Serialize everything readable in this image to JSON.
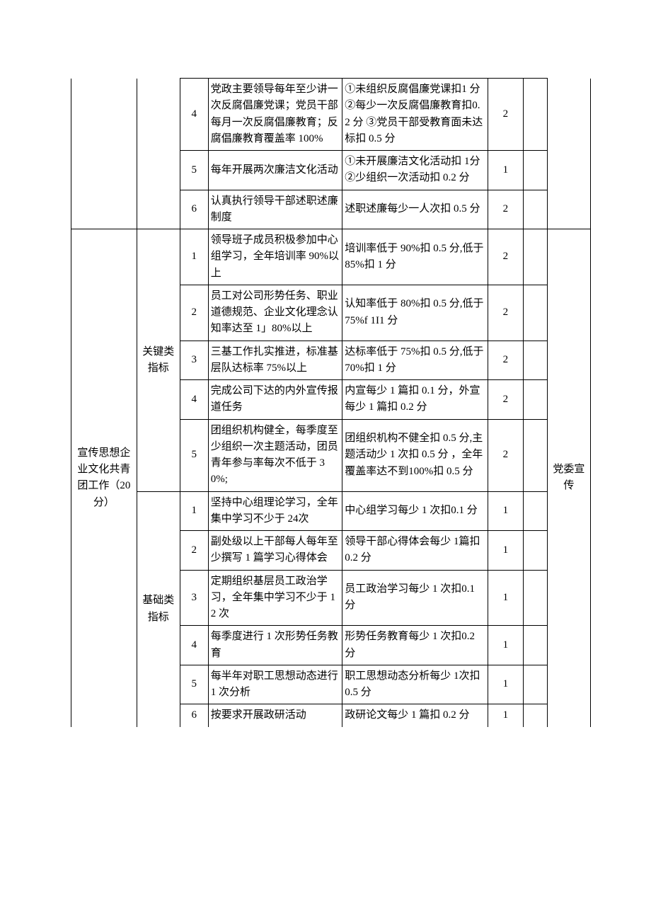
{
  "section_a": {
    "rows": [
      {
        "num": "4",
        "content": "党政主要领导每年至少讲一次反腐倡廉党课；党员干部每月一次反腐倡廉教育；反腐倡廉教育覆盖率 100%",
        "criteria": "①未组织反腐倡廉党课扣1 分\n②每少一次反腐倡廉教育扣0.2 分\n③党员干部受教育面未达标扣 0.5 分",
        "score": "2"
      },
      {
        "num": "5",
        "content": "每年开展两次廉洁文化活动",
        "criteria": "①未开展廉洁文化活动扣 1分\n②少组织一次活动扣 0.2 分",
        "score": "1"
      },
      {
        "num": "6",
        "content": "认真执行领导干部述职述廉制度",
        "criteria": "述职述廉每少一人次扣 0.5 分",
        "score": "2"
      }
    ]
  },
  "section_b": {
    "category": "宣传思想企业文化共青团工作（20分）",
    "dept": "党委宣传",
    "group_key": "关键类指标",
    "group_base": "基础类指标",
    "key_rows": [
      {
        "num": "1",
        "content": "领导班子成员积极参加中心组学习，全年培训率 90%以上",
        "criteria": "培训率低于 90%扣 0.5 分,低于 85%扣 1 分",
        "score": "2"
      },
      {
        "num": "2",
        "content": "员工对公司形势任务、职业道德规范、企业文化理念认知率达至 1」80%以上",
        "criteria": "认知率低于 80%扣 0.5 分,低于 75%f 1I1 分",
        "score": "2"
      },
      {
        "num": "3",
        "content": "三基工作扎实推进，标准基层队达标率 75%以上",
        "criteria": "达标率低于 75%扣 0.5 分,低于 70%扣 1 分",
        "score": "2"
      },
      {
        "num": "4",
        "content": "完成公司下达的内外宣传报道任务",
        "criteria": "内宣每少 1 篇扣 0.1 分，外宣每少 1 篇扣 0.2 分",
        "score": "2"
      },
      {
        "num": "5",
        "content": "团组织机构健全，每季度至少组织一次主题活动，团员青年参与率每次不低于 30%;",
        "criteria": "团组织机构不健全扣 0.5 分,主题活动少 1 次扣 0.5 分 ，全年覆盖率达不到100%扣 0.5 分",
        "score": "2"
      }
    ],
    "base_rows": [
      {
        "num": "1",
        "content": "坚持中心组理论学习，全年集中学习不少于 24次",
        "criteria": "中心组学习每少 1 次扣0.1 分",
        "score": "1"
      },
      {
        "num": "2",
        "content": "副处级以上干部每人每年至少撰写 1 篇学习心得体会",
        "criteria": "领导干部心得体会每少 1篇扣 0.2 分",
        "score": "1"
      },
      {
        "num": "3",
        "content": "定期组织基层员工政治学习，全年集中学习不少于 12 次",
        "criteria": "员工政治学习每少 1 次扣0.1 分",
        "score": "1"
      },
      {
        "num": "4",
        "content": "每季度进行 1 次形势任务教育",
        "criteria": "形势任务教育每少 1 次扣0.2 分",
        "score": "1"
      },
      {
        "num": "5",
        "content": "每半年对职工思想动态进行 1 次分析",
        "criteria": "职工思想动态分析每少 1次扣 0.5 分",
        "score": "1"
      },
      {
        "num": "6",
        "content": "按要求开展政研活动",
        "criteria": "政研论文每少 1 篇扣 0.2 分",
        "score": "1"
      }
    ]
  }
}
